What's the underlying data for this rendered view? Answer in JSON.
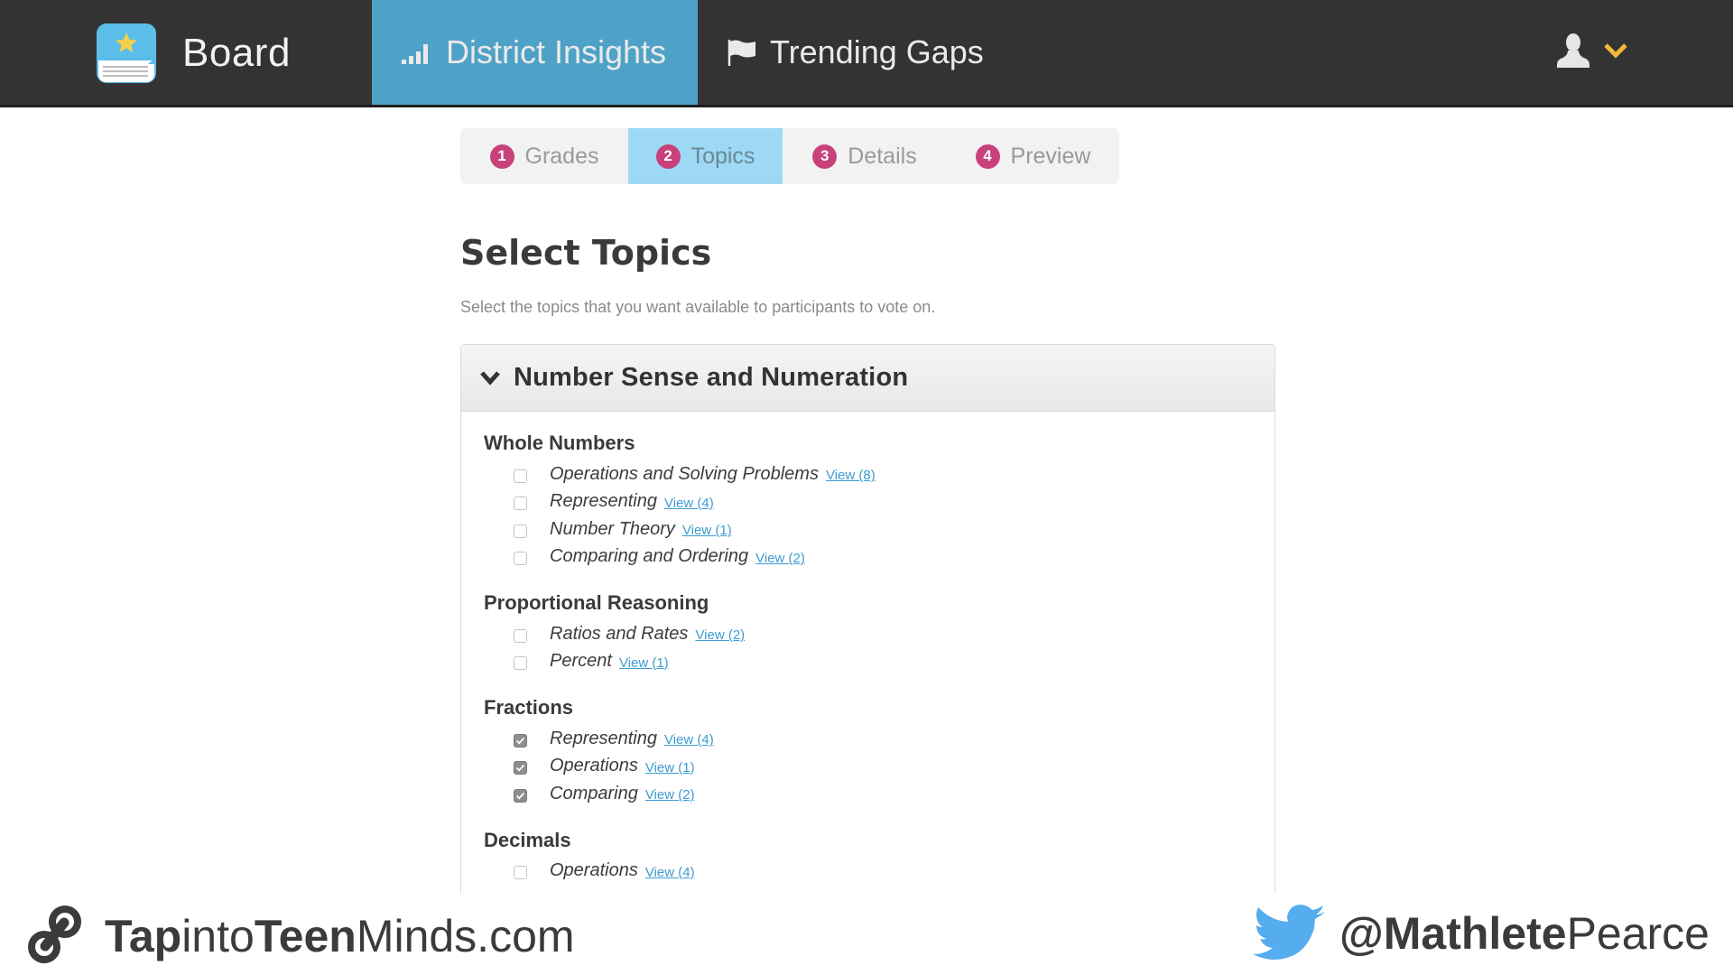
{
  "header": {
    "brand": "Board",
    "nav": [
      {
        "label": "District Insights",
        "icon": "signal-bars-icon",
        "active": true
      },
      {
        "label": "Trending Gaps",
        "icon": "flag-icon",
        "active": false
      }
    ],
    "user_icon": "user-icon",
    "user_menu_icon": "chevron-down-icon"
  },
  "steps": [
    {
      "number": "1",
      "label": "Grades",
      "active": false
    },
    {
      "number": "2",
      "label": "Topics",
      "active": true
    },
    {
      "number": "3",
      "label": "Details",
      "active": false
    },
    {
      "number": "4",
      "label": "Preview",
      "active": false
    }
  ],
  "main": {
    "title": "Select Topics",
    "subtitle": "Select the topics that you want available to participants to vote on.",
    "panel": {
      "title": "Number Sense and Numeration",
      "expanded": true,
      "groups": [
        {
          "title": "Whole Numbers",
          "topics": [
            {
              "label": "Operations and Solving Problems",
              "link": "View (8)",
              "checked": false
            },
            {
              "label": "Representing",
              "link": "View (4)",
              "checked": false
            },
            {
              "label": "Number Theory",
              "link": "View (1)",
              "checked": false
            },
            {
              "label": "Comparing and Ordering",
              "link": "View (2)",
              "checked": false
            }
          ]
        },
        {
          "title": "Proportional Reasoning",
          "topics": [
            {
              "label": "Ratios and Rates",
              "link": "View (2)",
              "checked": false
            },
            {
              "label": "Percent",
              "link": "View (1)",
              "checked": false
            }
          ]
        },
        {
          "title": "Fractions",
          "topics": [
            {
              "label": "Representing",
              "link": "View (4)",
              "checked": true
            },
            {
              "label": "Operations",
              "link": "View (1)",
              "checked": true
            },
            {
              "label": "Comparing",
              "link": "View (2)",
              "checked": true
            }
          ]
        },
        {
          "title": "Decimals",
          "topics": [
            {
              "label": "Operations",
              "link": "View (4)",
              "checked": false
            }
          ]
        }
      ]
    }
  },
  "footer": {
    "site_bold_1": "Tap",
    "site_light_1": "into",
    "site_bold_2": "Teen",
    "site_light_2": "Minds.com",
    "handle_bold": "@Mathlete",
    "handle_light": "Pearce"
  },
  "colors": {
    "header_bg": "#333333",
    "active_nav": "#4fa2c7",
    "active_step": "#9dd9f5",
    "step_badge": "#c8417a",
    "link": "#3d9bd1",
    "user_chevron": "#f0b83c",
    "twitter": "#55acee"
  }
}
